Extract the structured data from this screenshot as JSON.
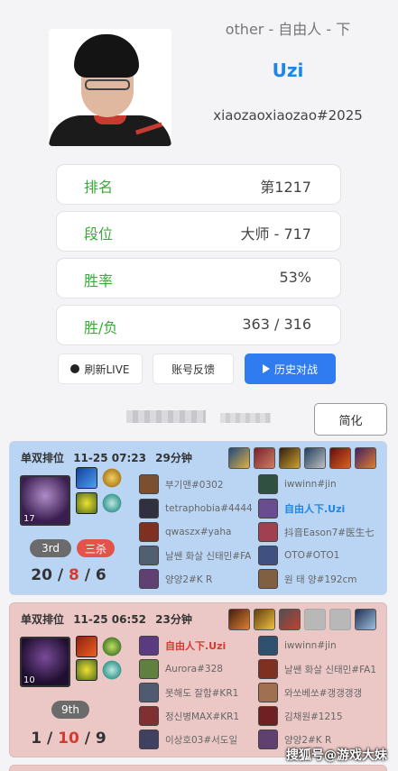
{
  "profile": {
    "subtitle": "other - 自由人 - 下",
    "name": "Uzi",
    "tag": "xiaozaoxiaozao#2025"
  },
  "stats": [
    {
      "label": "排名",
      "value": "第1217"
    },
    {
      "label": "段位",
      "value": "大师 - 717"
    },
    {
      "label": "胜率",
      "value": "53%"
    },
    {
      "label": "胜/负",
      "value": "363 / 316"
    }
  ],
  "actions": {
    "refresh": "刷新LIVE",
    "feedback": "账号反馈",
    "history": "历史对战",
    "simplify": "简化"
  },
  "matches": [
    {
      "result": "win",
      "queue": "单双排位",
      "time": "11-25 07:23",
      "duration": "29分钟",
      "champion_level": "17",
      "rank_badge": "3rd",
      "multikill": "三杀",
      "kills": "20",
      "deaths": "8",
      "assists": "6",
      "team_a": [
        "부기맨#0302",
        "tetraphobia#4444",
        "qwaszx#yaha",
        "날쌘 화살 신태민#FA",
        "양양2#K R"
      ],
      "team_b": [
        "iwwinn#jin",
        "自由人下.Uzi",
        "抖音Eason7#医生七",
        "OTO#OTO1",
        "원 태 양#192cm"
      ],
      "self_team": "b",
      "self_index": 1
    },
    {
      "result": "loss",
      "queue": "单双排位",
      "time": "11-25 06:52",
      "duration": "23分钟",
      "champion_level": "10",
      "rank_badge": "9th",
      "multikill": "",
      "kills": "1",
      "deaths": "10",
      "assists": "9",
      "team_a": [
        "自由人下.Uzi",
        "Aurora#328",
        "못해도 잘함#KR1",
        "정신병MAX#KR1",
        "이상호03#서도일"
      ],
      "team_b": [
        "iwwinn#jin",
        "날쌘 화살 신태민#FA1",
        "와쏘베쏘#갱갱갱갱",
        "김채원#1215",
        "양양2#K R"
      ],
      "self_team": "a",
      "self_index": 0
    }
  ],
  "watermark": "搜狐号@游戏大妹",
  "colors": {
    "accent_blue": "#1e86e8",
    "label_green": "#3aaa3a",
    "win_bg": "#b9d5f3",
    "loss_bg": "#ebc8c6",
    "death_red": "#d63a2f",
    "primary_button": "#2f7bf0"
  },
  "icons": {
    "refresh": "record-dot-icon",
    "history": "play-triangle-icon"
  }
}
